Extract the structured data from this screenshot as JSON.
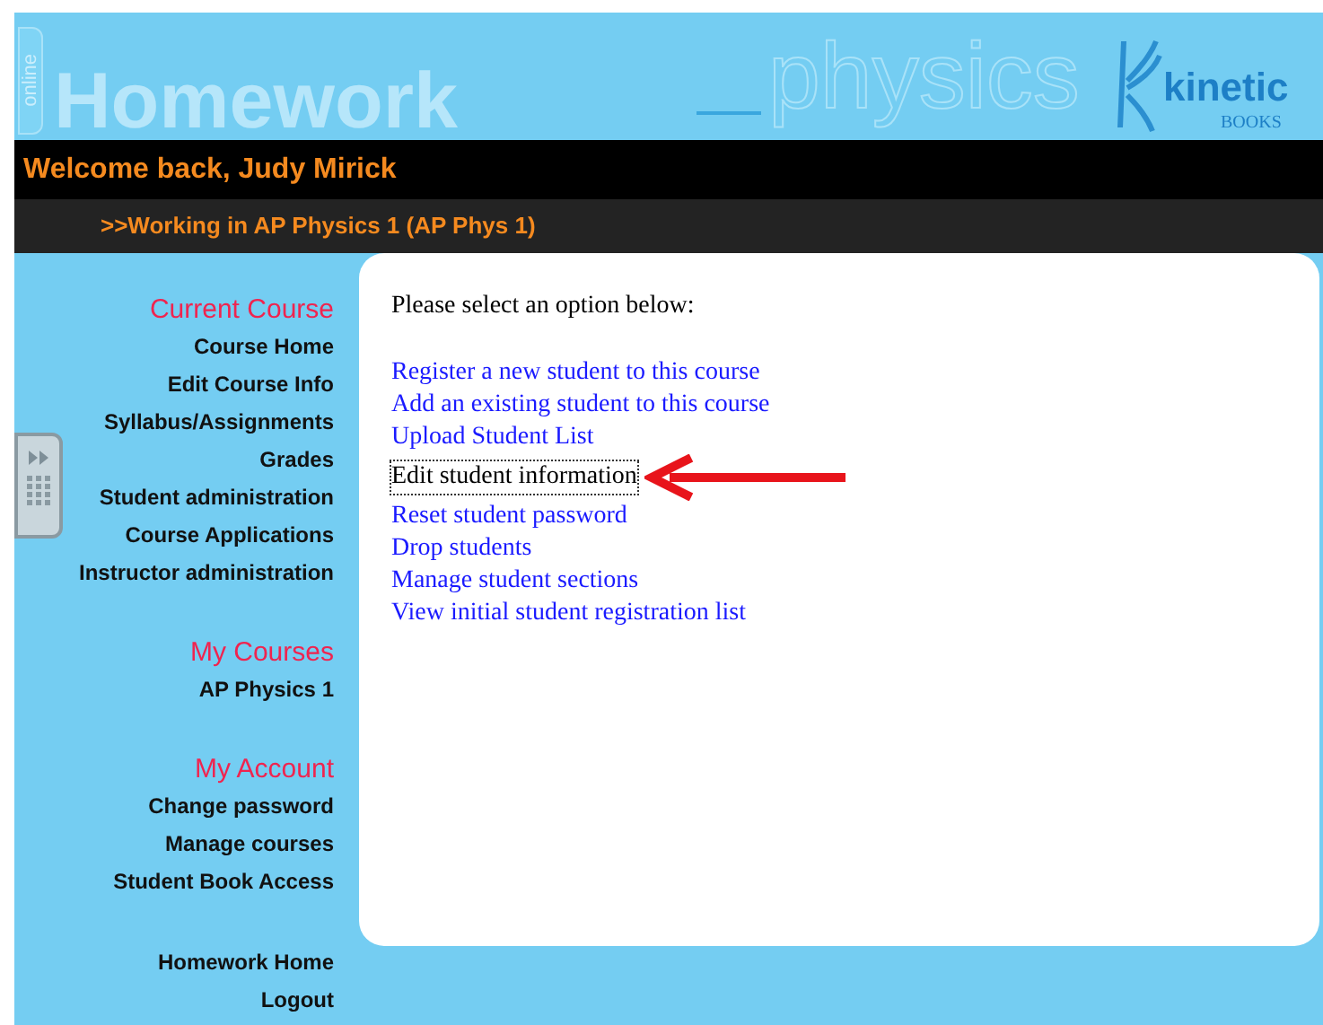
{
  "header": {
    "badge": "online",
    "title": "Homework",
    "subject": "physics",
    "brand": "kinetic",
    "brand_sub": "BOOKS"
  },
  "welcome": "Welcome back, Judy Mirick",
  "course_bar": ">>Working in AP Physics 1 (AP Phys 1)",
  "sidebar": {
    "sections": [
      {
        "heading": "Current Course",
        "items": [
          "Course Home",
          "Edit Course Info",
          "Syllabus/Assignments",
          "Grades",
          "Student administration",
          "Course Applications",
          "Instructor administration"
        ]
      },
      {
        "heading": "My Courses",
        "items": [
          "AP Physics 1"
        ]
      },
      {
        "heading": "My Account",
        "items": [
          "Change password",
          "Manage courses",
          "Student Book Access"
        ]
      },
      {
        "items": [
          "Homework Home",
          "Logout"
        ]
      }
    ]
  },
  "main": {
    "prompt": "Please select an option below:",
    "options": [
      {
        "label": "Register a new student to this course",
        "selected": false
      },
      {
        "label": "Add an existing student to this course",
        "selected": false
      },
      {
        "label": "Upload Student List",
        "selected": false
      },
      {
        "label": "Edit student information",
        "selected": true
      },
      {
        "label": "Reset student password",
        "selected": false
      },
      {
        "label": "Drop students",
        "selected": false
      },
      {
        "label": "Manage student sections",
        "selected": false
      },
      {
        "label": "View initial student registration list",
        "selected": false
      }
    ]
  }
}
